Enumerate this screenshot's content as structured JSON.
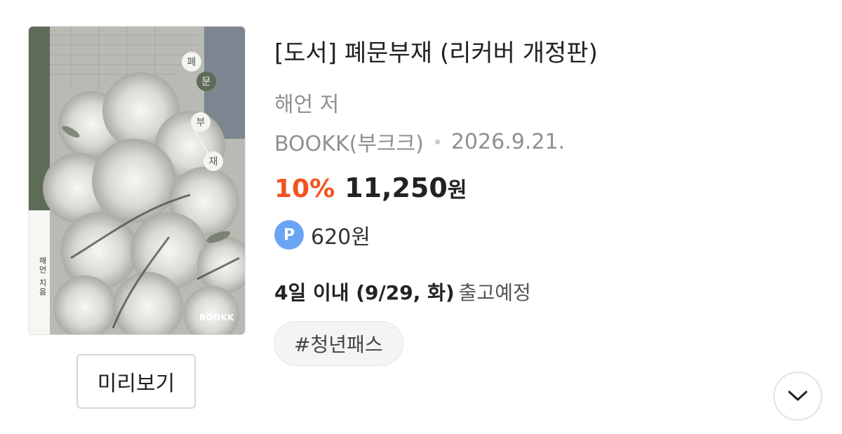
{
  "book": {
    "title": "[도서] 폐문부재 (리커버 개정판)",
    "author": "해언 저",
    "publisher": "BOOKK(부크크)",
    "date": "2026.9.21.",
    "discount": "10%",
    "price": "11,250",
    "price_unit": "원",
    "point": "620원",
    "point_icon_letter": "P",
    "shipping_strong": "4일 이내 (9/29, 화)",
    "shipping_rest": "출고예정",
    "tag": "#청년패스"
  },
  "cover": {
    "title_chars": [
      "폐",
      "문",
      "부",
      "재"
    ],
    "spine_text": "해언 지음",
    "logo": "BOOKK"
  },
  "buttons": {
    "preview": "미리보기"
  },
  "icons": {
    "expand": "chevron-down-icon",
    "point": "point-icon"
  },
  "colors": {
    "discount": "#f2541f",
    "point": "#6aa5f5",
    "spine": "#5e6c57"
  }
}
